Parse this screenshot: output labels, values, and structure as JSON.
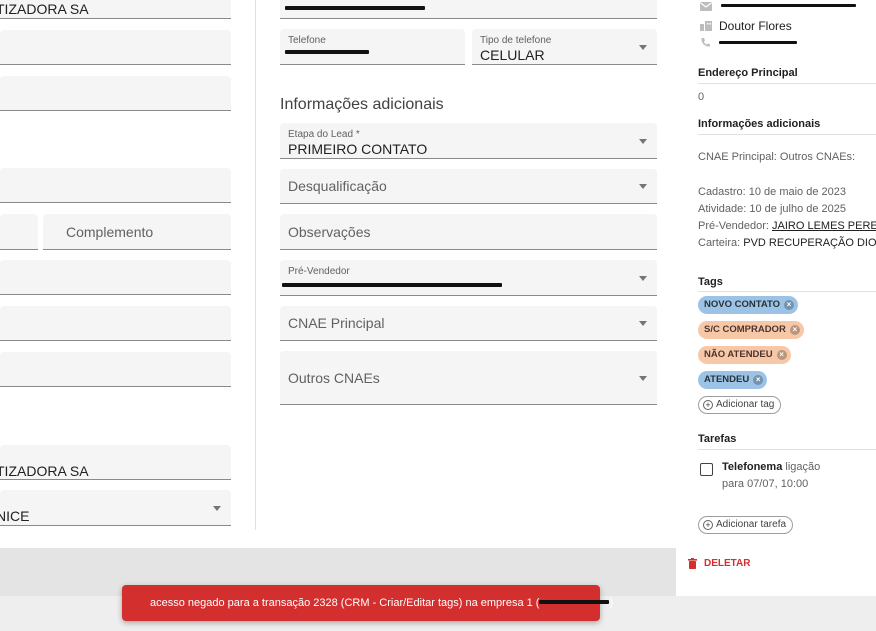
{
  "left_fields": {
    "razao_social_value": "TIZADORA SA",
    "complemento_placeholder": "Complemento",
    "nome_fantasia_value": "TIZADORA SA",
    "carteira_value": "NICE"
  },
  "contact": {
    "telefone_label": "Telefone",
    "tipo_label": "Tipo de telefone",
    "tipo_value": "CELULAR"
  },
  "additional_info": {
    "title": "Informações adicionais",
    "etapa_label": "Etapa do Lead *",
    "etapa_value": "PRIMEIRO CONTATO",
    "desqualificacao_placeholder": "Desqualificação",
    "observacoes_placeholder": "Observações",
    "pre_vendedor_label": "Pré-Vendedor",
    "cnae_principal_placeholder": "CNAE Principal",
    "outros_cnaes_placeholder": "Outros CNAEs"
  },
  "sidebar": {
    "contact_name": "Doutor Flores",
    "endereco_heading": "Endereço Principal",
    "endereco_value": "0",
    "info_heading": "Informações adicionais",
    "cnae_line": "CNAE Principal: Outros CNAEs:",
    "cadastro_line": "Cadastro: 10 de maio de 2023",
    "atividade_line": "Atividade: 10 de julho de 2025",
    "pre_vendedor_prefix": "Pré-Vendedor: ",
    "pre_vendedor_name": "JAIRO LEMES PEREIR",
    "carteira_prefix": "Carteira: ",
    "carteira_name": "PVD RECUPERAÇÃO DIONIC",
    "tags_heading": "Tags",
    "tags": [
      {
        "label": "NOVO CONTATO",
        "color": "#9cc3e6"
      },
      {
        "label": "S/C COMPRADOR",
        "color": "#f7c8a8"
      },
      {
        "label": "NÃO ATENDEU",
        "color": "#f7c8a8"
      },
      {
        "label": "ATENDEU",
        "color": "#9cc3e6"
      }
    ],
    "add_tag_label": "Adicionar tag",
    "tarefas_heading": "Tarefas",
    "task_title": "Telefonema",
    "task_type": " ligação",
    "task_due": "para 07/07, 10:00",
    "add_task_label": "Adicionar tarefa",
    "delete_label": "DELETAR"
  },
  "toast": {
    "message": "acesso negado para a transação 2328 (CRM - Criar/Editar tags) na empresa 1 (",
    "message_end": ")"
  },
  "colors": {
    "toast_bg": "#d32f2f",
    "delete": "#d32f2f"
  }
}
